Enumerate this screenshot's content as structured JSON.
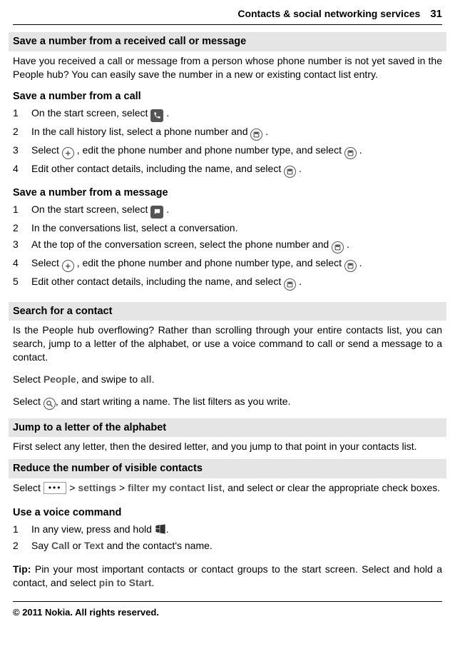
{
  "header": {
    "title": "Contacts & social networking services",
    "page": "31"
  },
  "sec1": {
    "heading": "Save a number from a received call or message",
    "intro": "Have you received a call or message from a person whose phone number is not yet saved in the People hub? You can easily save the number in a new or existing contact list entry.",
    "sub_call": "Save a number from a call",
    "call_steps": [
      {
        "n": "1",
        "pre": "On the start screen, select ",
        "post": "."
      },
      {
        "n": "2",
        "pre": "In the call history list, select a phone number and ",
        "post": "."
      },
      {
        "n": "3",
        "pre": "Select ",
        "mid": ", edit the phone number and phone number type, and select ",
        "post": "."
      },
      {
        "n": "4",
        "pre": "Edit other contact details, including the name, and select ",
        "post": "."
      }
    ],
    "sub_msg": "Save a number from a message",
    "msg_steps": [
      {
        "n": "1",
        "pre": "On the start screen, select ",
        "post": "."
      },
      {
        "n": "2",
        "pre": "In the conversations list, select a conversation."
      },
      {
        "n": "3",
        "pre": "At the top of the conversation screen, select the phone number and ",
        "post": "."
      },
      {
        "n": "4",
        "pre": "Select ",
        "mid": ", edit the phone number and phone number type, and select ",
        "post": "."
      },
      {
        "n": "5",
        "pre": "Edit other contact details, including the name, and select ",
        "post": "."
      }
    ]
  },
  "sec2": {
    "heading": "Search for a contact",
    "intro": "Is the People hub overflowing? Rather than scrolling through your entire contacts list, you can search, jump to a letter of the alphabet, or use a voice command to call or send a message to a contact.",
    "select_pre": "Select ",
    "people": "People",
    "select_mid": ", and swipe to ",
    "all": "all",
    "select_post": ".",
    "search_pre": "Select ",
    "search_post": ", and start writing a name. The list filters as you write."
  },
  "sec3": {
    "heading": "Jump to a letter of the alphabet",
    "body": "First select any letter, then the desired letter, and you jump to that point in your contacts list."
  },
  "sec4": {
    "heading": "Reduce the number of visible contacts",
    "pre": "Select ",
    "gt": " > ",
    "settings": "settings",
    "gt2": " > ",
    "filter": "filter my contact list",
    "post": ", and select or clear the appropriate check boxes."
  },
  "sec5": {
    "heading": "Use a voice command",
    "steps": [
      {
        "n": "1",
        "pre": "In any view, press and hold ",
        "post": "."
      },
      {
        "n": "2",
        "pre": "Say ",
        "call": "Call",
        "or": " or ",
        "text": "Text",
        "post": " and the contact's name."
      }
    ],
    "tip_label": "Tip: ",
    "tip_pre": "Pin your most important contacts or contact groups to the start screen. Select and hold a contact, and select ",
    "pin": "pin to Start",
    "tip_post": "."
  },
  "footer": "© 2011 Nokia. All rights reserved."
}
